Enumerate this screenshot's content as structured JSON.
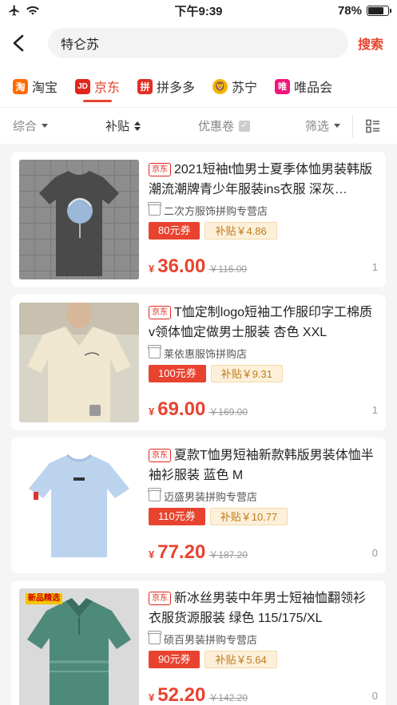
{
  "status_bar": {
    "time": "下午9:39",
    "battery": "78%",
    "battery_level": 0.78
  },
  "search": {
    "query": "特仑苏",
    "button": "搜索"
  },
  "platforms": [
    {
      "label": "淘宝",
      "icon": "taobao-icon",
      "icon_text": "淘",
      "active": false
    },
    {
      "label": "京东",
      "icon": "jd-icon",
      "icon_text": "JD",
      "active": true
    },
    {
      "label": "拼多多",
      "icon": "pinduoduo-icon",
      "icon_text": "拼",
      "active": false
    },
    {
      "label": "苏宁",
      "icon": "suning-icon",
      "icon_text": "🦁",
      "active": false
    },
    {
      "label": "唯品会",
      "icon": "vipshop-icon",
      "icon_text": "唯",
      "active": false
    }
  ],
  "sort": {
    "comprehensive": "综合",
    "subsidy": "补贴",
    "coupon": "优惠卷",
    "filter": "筛选"
  },
  "products": [
    {
      "badge": "京东",
      "title": "2021短袖t恤男士夏季体恤男装韩版潮流潮牌青少年服装ins衣服 深灰…",
      "shop": "二次方服饰拼购专营店",
      "coupon": "80元券",
      "subsidy": "补贴￥4.86",
      "currency": "¥",
      "price": "36.00",
      "orig_price": "￥116.00",
      "sold": "1"
    },
    {
      "badge": "京东",
      "title": "T恤定制logo短袖工作服印字工棉质v领体恤定做男士服装 杏色 XXL",
      "shop": "莱依惠服饰拼购店",
      "coupon": "100元券",
      "subsidy": "补贴￥9.31",
      "currency": "¥",
      "price": "69.00",
      "orig_price": "￥169.00",
      "sold": "1"
    },
    {
      "badge": "京东",
      "title": "夏款T恤男短袖新款韩版男装体恤半袖衫服装 蓝色 M",
      "shop": "迈盛男装拼购专营店",
      "coupon": "110元券",
      "subsidy": "补贴￥10.77",
      "currency": "¥",
      "price": "77.20",
      "orig_price": "￥187.20",
      "sold": "0"
    },
    {
      "badge": "京东",
      "title": "新冰丝男装中年男士短袖恤翻领衫衣服货源服装 绿色 115/175/XL",
      "shop": "硕百男装拼购专营店",
      "coupon": "90元券",
      "subsidy": "补贴￥5.64",
      "currency": "¥",
      "price": "52.20",
      "orig_price": "￥142.20",
      "sold": "0",
      "image_badge": "新品精选"
    }
  ]
}
